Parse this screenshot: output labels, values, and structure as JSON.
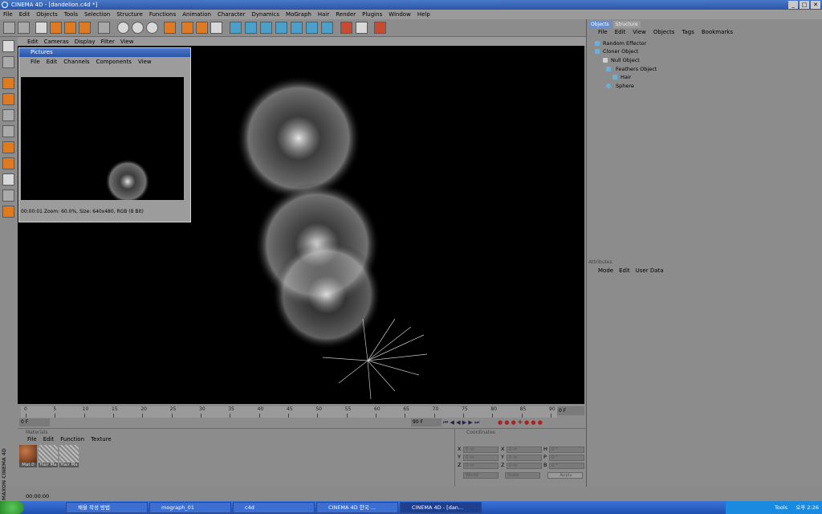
{
  "window": {
    "title": "CINEMA 4D - [dandelion.c4d *]"
  },
  "menubar": [
    "File",
    "Edit",
    "Objects",
    "Tools",
    "Selection",
    "Structure",
    "Functions",
    "Animation",
    "Character",
    "Dynamics",
    "MoGraph",
    "Hair",
    "Render",
    "Plugins",
    "Window",
    "Help"
  ],
  "viewport_menu": [
    "Edit",
    "Cameras",
    "Display",
    "Filter",
    "View"
  ],
  "pictures": {
    "title": "Pictures",
    "menu": [
      "File",
      "Edit",
      "Channels",
      "Components",
      "View"
    ],
    "status": "00:00:01 Zoom: 60.0%, Size: 640x480, RGB (8 Bit)"
  },
  "objects": {
    "tabs": [
      "Objects",
      "Structure"
    ],
    "menu": [
      "File",
      "Edit",
      "View",
      "Objects",
      "Tags",
      "Bookmarks"
    ],
    "rows": [
      {
        "name": "Random Effector"
      },
      {
        "name": "Cloner Object"
      },
      {
        "name": "Null Object"
      },
      {
        "name": "Feathers Object"
      },
      {
        "name": "Hair"
      },
      {
        "name": "Sphere"
      }
    ]
  },
  "attributes": {
    "header": "Attributes",
    "menu": [
      "Mode",
      "Edit",
      "User Data"
    ]
  },
  "timeline": {
    "ticks": [
      "0",
      "5",
      "10",
      "15",
      "20",
      "25",
      "30",
      "35",
      "40",
      "45",
      "50",
      "55",
      "60",
      "65",
      "70",
      "75",
      "80",
      "85",
      "90"
    ],
    "end_field": "0 F",
    "start_field": "0 F",
    "max_field": "90 F"
  },
  "materials": {
    "header": "Materials",
    "menu": [
      "File",
      "Edit",
      "Function",
      "Texture"
    ],
    "items": [
      "Mat.0",
      "Hair Ma",
      "Hair Ma"
    ]
  },
  "coordinates": {
    "header": "Coordinates",
    "col_labels": [
      "X",
      "Y",
      "Z",
      "X",
      "Y",
      "Z",
      "H",
      "P",
      "B"
    ],
    "values": [
      "0 m",
      "0 m",
      "0 m",
      "0 m",
      "0 m",
      "0 m",
      "0 °",
      "0 °",
      "0 °"
    ],
    "dropdowns": [
      "World",
      "Scale"
    ],
    "apply": "Apply"
  },
  "status_time": "00:00:00",
  "brand": "MAXON CINEMA 4D",
  "taskbar": {
    "tasks": [
      "채울 작성 방법",
      "mograph_01",
      "c4d",
      "CINEMA 4D 한국 ...",
      "CINEMA 4D - [dan..."
    ],
    "tray_label": "Tools",
    "clock": "오후 2:26"
  }
}
